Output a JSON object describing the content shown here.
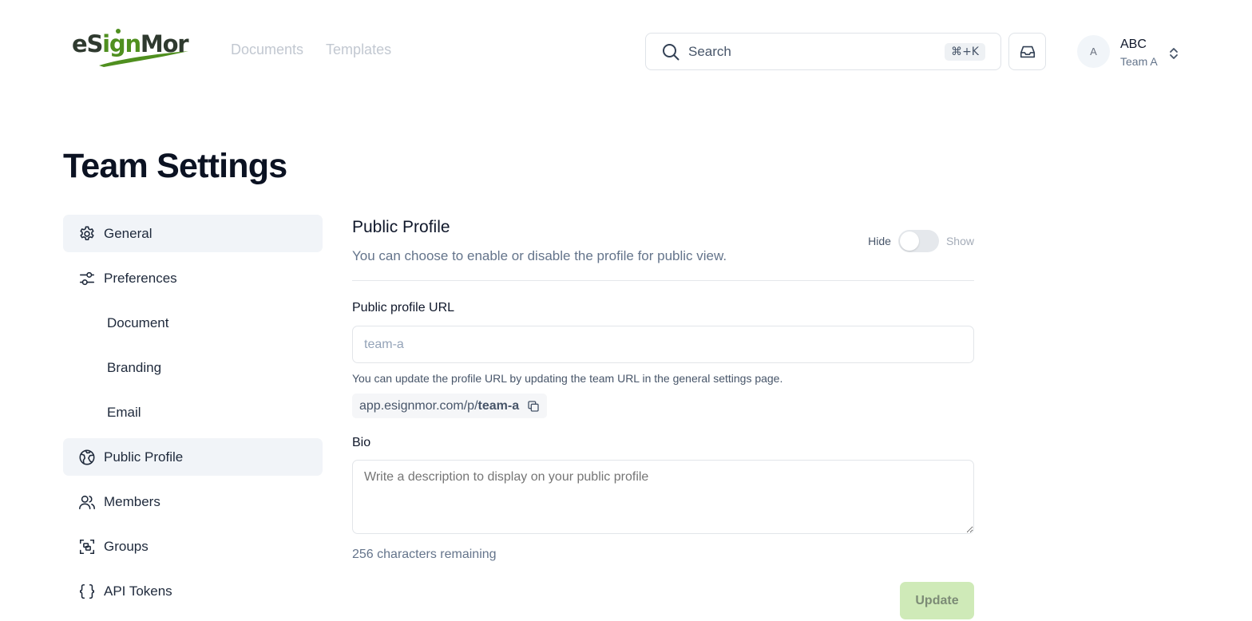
{
  "brand": {
    "logo_text_1": "eS",
    "logo_text_2": "ign",
    "logo_text_3": "Mor",
    "colors": {
      "green": "#4f8f1f",
      "dark": "#2f3a2f"
    }
  },
  "topnav": {
    "items": [
      {
        "label": "Documents"
      },
      {
        "label": "Templates"
      }
    ]
  },
  "search": {
    "label": "Search",
    "shortcut": "⌘+K"
  },
  "user": {
    "avatar_initial": "A",
    "name": "ABC",
    "team": "Team A"
  },
  "page": {
    "title": "Team Settings"
  },
  "sidebar": {
    "items": [
      {
        "label": "General",
        "icon": "gear-icon",
        "active": true
      },
      {
        "label": "Preferences",
        "icon": "sliders-icon",
        "active": false
      },
      {
        "label": "Document",
        "icon": "",
        "active": false
      },
      {
        "label": "Branding",
        "icon": "",
        "active": false
      },
      {
        "label": "Email",
        "icon": "",
        "active": false
      },
      {
        "label": "Public Profile",
        "icon": "globe-icon",
        "active": true
      },
      {
        "label": "Members",
        "icon": "users-icon",
        "active": false
      },
      {
        "label": "Groups",
        "icon": "group-icon",
        "active": false
      },
      {
        "label": "API Tokens",
        "icon": "braces-icon",
        "active": false
      }
    ]
  },
  "profile": {
    "title": "Public Profile",
    "description": "You can choose to enable or disable the profile for public view.",
    "toggle": {
      "left_label": "Hide",
      "right_label": "Show",
      "enabled": false
    },
    "url_label": "Public profile URL",
    "url_placeholder": "team-a",
    "url_helper": "You can update the profile URL by updating the team URL in the general settings page.",
    "url_prefix": "app.esignmor.com/p/",
    "url_slug": "team-a",
    "bio_label": "Bio",
    "bio_placeholder": "Write a description to display on your public profile",
    "remaining": "256 characters remaining",
    "update_label": "Update"
  }
}
